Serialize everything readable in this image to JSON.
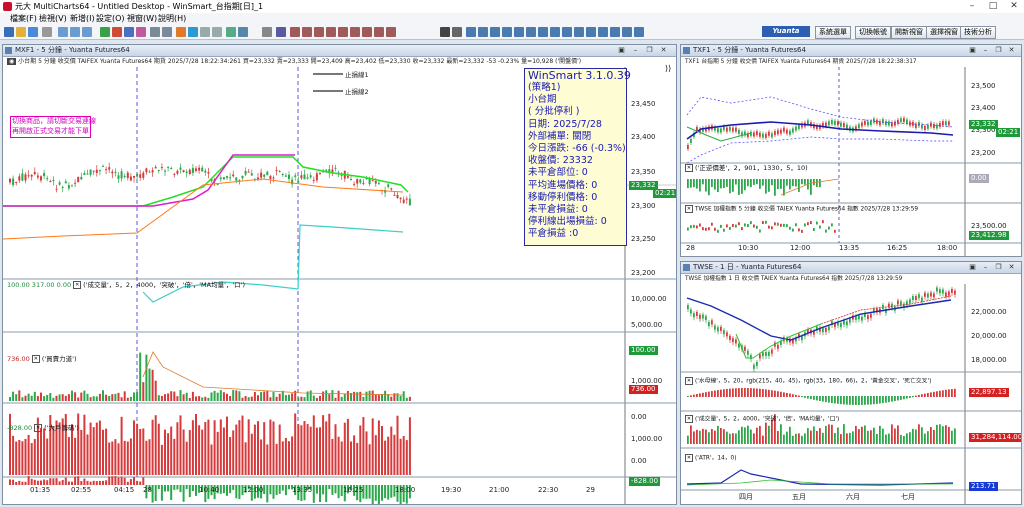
{
  "window": {
    "title": "元大 MultiCharts64 - Untitled Desktop - WinSmart_台指期[日]_1"
  },
  "menu": [
    "檔案(F)",
    "檢視(V)",
    "新增(I)",
    "設定(O)",
    "視窗(W)",
    "說明(H)"
  ],
  "toolbar_right": [
    "系統選單",
    "切換帳號",
    "開新視窗",
    "選擇視窗",
    "技術分析"
  ],
  "brand": "Yuanta",
  "left_chart": {
    "title": "MXF1 - 5 分鐘 - Yuanta Futures64",
    "info": "小台期 5 分鐘 收交價 TAIFEX Yuanta Futures64 期貨 2025/7/28 18:22:34:261 買=23,332 賣=23,333 開=23,409 高=23,402 低=23,330 收=23,332 最新=23,332 -53 -0.23% 量=10,928 ('開盤價')",
    "note_lines": [
      "切換商品，請切斷交易連線",
      "再開啟正式交易才能下單!"
    ],
    "legend": [
      "止損線1",
      "止損線2"
    ],
    "price_axis": [
      "23,450",
      "23,400",
      "23,350",
      "23,300",
      "23,250",
      "23,200"
    ],
    "price_tag": "23,332",
    "time_tag": "02:21",
    "volume_info": "100.00  317.00  0.00",
    "volume_title": "('成交量'，5，2，4000，'突破'，'倍'，'MA均量'，'口')",
    "volume_axis": [
      "10,000.00",
      "5,000.00"
    ],
    "volume_tag": "100.00",
    "pressure_info": "736.00",
    "pressure_title": "('買賣力道')",
    "pressure_axis": [
      "1,000.00",
      "0.00"
    ],
    "pressure_tag": "736.00",
    "big_info": "-828.00",
    "big_title": "('大戶籌碼')",
    "big_axis": [
      "1,000.00",
      "0.00"
    ],
    "big_tag": "-828.00",
    "time_axis": [
      "01:35",
      "02:55",
      "04:15",
      "28",
      "10:40",
      "12:00",
      "13:35",
      "16:25",
      "18:00",
      "19:30",
      "21:00",
      "22:30",
      "29"
    ]
  },
  "winsmart": {
    "lines": [
      "WinSmart 3.1.0.39",
      "(策略1)",
      "小台期",
      "( 分批停利 )",
      "日期: 2025/7/28",
      "外部補單: 關閉",
      "今日漲跌: -66 (-0.3%)",
      "收盤價: 23332",
      "未平倉部位: 0",
      "平均進場價格: 0",
      "移動停利價格: 0",
      "未平倉損益: 0",
      "停利線出場損益: 0",
      "平倉損益 :0"
    ]
  },
  "txf_chart": {
    "title": "TXF1 - 5 分鐘 - Yuanta Futures64",
    "info": "TXF1  台指期 5 分鐘 收交價 TAIFEX Yuanta Futures64 期貨 2025/7/28 18:22:38:317",
    "price_axis": [
      "23,500",
      "23,400",
      "23,300",
      "23,200"
    ],
    "price_tag": "23,332",
    "time_tag": "02:21",
    "ind1_title": "('正逆價差'，2，901，1330，5，10)",
    "ind1_tag": "0.00",
    "ind2_info": "TWSE  加權指數 5 分鐘 收交價 TAIEX Yuanta Futures64 指數 2025/7/28 13:29:59",
    "ind2_axis": "23,500.00",
    "ind2_tag": "23,412.98",
    "time_axis": [
      "28",
      "10:30",
      "12:00",
      "13:35",
      "16:25",
      "18:00"
    ]
  },
  "twse_chart": {
    "title": "TWSE - 1 日 - Yuanta Futures64",
    "info": "TWSE  加權指數 1 日 收交價 TAIEX Yuanta Futures64 指數 2025/7/28 13:29:59",
    "price_axis": [
      "22,000.00",
      "20,000.00",
      "18,000.00"
    ],
    "price_tag": "",
    "ind1_title": "('水母線'，5，20，rgb(215，40，45)，rgb(33，180，66)，2，'黃金交叉'，'死亡交叉')",
    "ind1_tag": "22,897.13",
    "ind2_title": "('成交量'，5，2，4000，'突破'，'倍'，'MA均量'，'口')",
    "ind2_tag": "31,284,114.00",
    "ind3_title": "('ATR'，14，0)",
    "ind3_tag": "213.71",
    "time_axis": [
      "四月",
      "五月",
      "六月",
      "七月"
    ]
  },
  "colors": {
    "accent": "#1a1ab8",
    "bull": "#d63a3a",
    "bear": "#2aa84a",
    "ma_magenta": "#e01ad0",
    "ma_orange": "#ff7a1a",
    "ma_green": "#22e022",
    "ma_cyan": "#3ad0c8",
    "tag_green": "#1f9a3a",
    "tag_red": "#d42020",
    "tag_blue": "#1a3ad8"
  }
}
